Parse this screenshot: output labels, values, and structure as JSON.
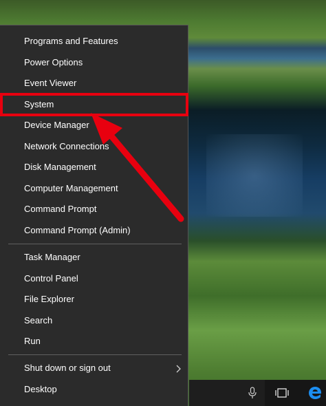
{
  "menu": {
    "items_group1": [
      "Programs and Features",
      "Power Options",
      "Event Viewer",
      "System",
      "Device Manager",
      "Network Connections",
      "Disk Management",
      "Computer Management",
      "Command Prompt",
      "Command Prompt (Admin)"
    ],
    "items_group2": [
      "Task Manager",
      "Control Panel",
      "File Explorer",
      "Search",
      "Run"
    ],
    "items_group3": [
      "Shut down or sign out",
      "Desktop"
    ],
    "highlighted_item": "System",
    "submenu_arrow_icon": "chevron-right-icon"
  },
  "annotation": {
    "color": "#e8000f"
  },
  "taskbar": {
    "icons": [
      "microphone-icon",
      "task-view-icon",
      "edge-icon"
    ]
  }
}
